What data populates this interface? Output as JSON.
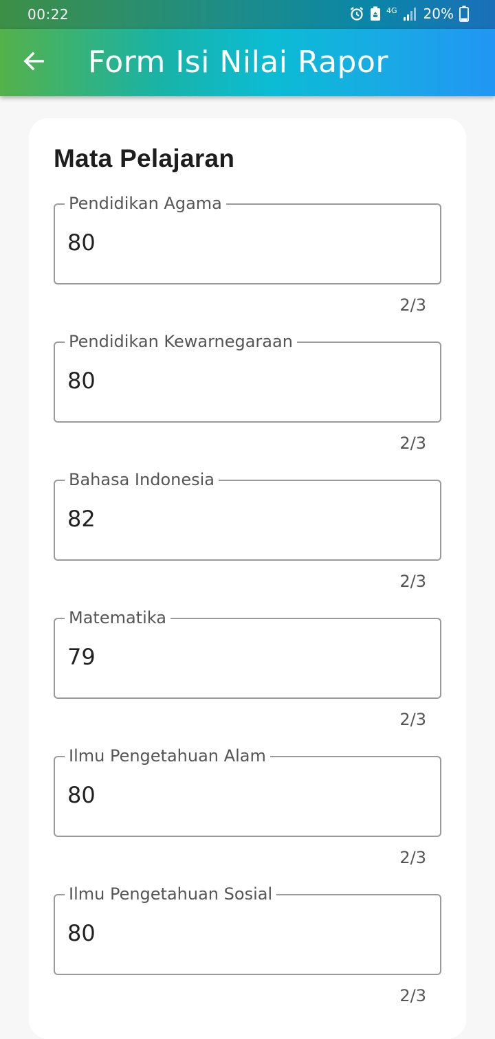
{
  "status_bar": {
    "time": "00:22",
    "network": "4G",
    "battery": "20%"
  },
  "app_bar": {
    "title": "Form Isi Nilai Rapor",
    "back_icon": "arrow-left-icon"
  },
  "form": {
    "section_title": "Mata Pelajaran",
    "fields": [
      {
        "label": "Pendidikan Agama",
        "value": "80",
        "counter": "2/3"
      },
      {
        "label": "Pendidikan Kewarnegaraan",
        "value": "80",
        "counter": "2/3"
      },
      {
        "label": "Bahasa Indonesia",
        "value": "82",
        "counter": "2/3"
      },
      {
        "label": "Matematika",
        "value": "79",
        "counter": "2/3"
      },
      {
        "label": "Ilmu Pengetahuan Alam",
        "value": "80",
        "counter": "2/3"
      },
      {
        "label": "Ilmu Pengetahuan Sosial",
        "value": "80",
        "counter": "2/3"
      }
    ]
  },
  "colors": {
    "app_bar_start": "#55b14a",
    "app_bar_end": "#2196f3",
    "field_border": "#9a9a9a"
  }
}
